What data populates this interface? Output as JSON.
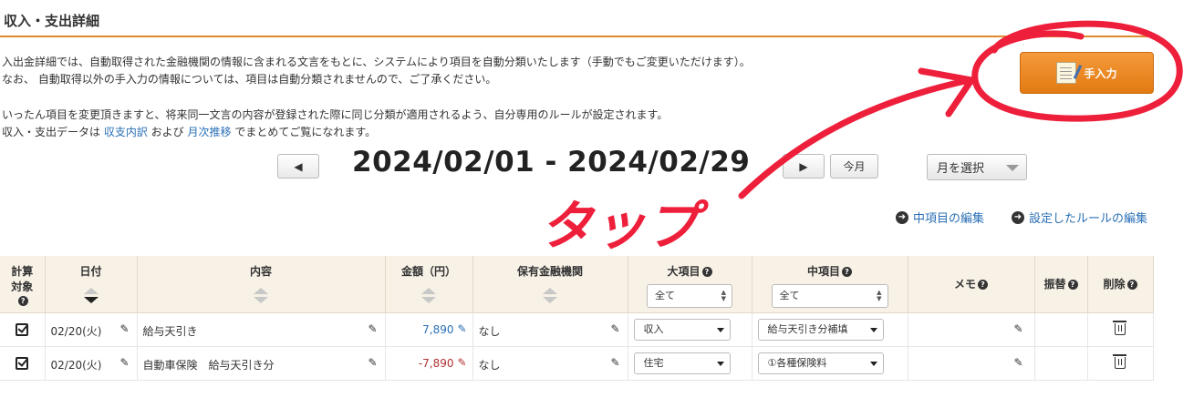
{
  "page": {
    "title": "収入・支出詳細"
  },
  "description": {
    "line1": "入出金詳細では、自動取得された金融機関の情報に含まれる文言をもとに、システムにより項目を自動分類いたします（手動でもご変更いただけます）。",
    "line2": "なお、 自動取得以外の手入力の情報については、項目は自動分類されませんので、ご了承ください。",
    "line3": "いったん項目を変更頂きますと、将来同一文言の内容が登録された際に同じ分類が適用されるよう、自分専用のルールが設定されます。",
    "line4_prefix": "収入・支出データは ",
    "link_summary": "収支内訳",
    "line4_mid": " および ",
    "link_monthly": "月次推移",
    "line4_suffix": " でまとめてご覧になれます。"
  },
  "manual_entry": {
    "label": "手入力",
    "icon": "notepad-icon"
  },
  "period": {
    "prev_label": "◀",
    "next_label": "▶",
    "range": "2024/02/01 - 2024/02/29",
    "this_month": "今月",
    "month_select": "月を選択"
  },
  "edit_links": {
    "categories": "中項目の編集",
    "rules": "設定したルールの編集"
  },
  "annotation": {
    "handwritten_text": "タップ",
    "color": "#ee1f3b"
  },
  "table": {
    "headers": {
      "target_line1": "計算",
      "target_line2": "対象",
      "date": "日付",
      "content": "内容",
      "amount": "金額（円）",
      "institution": "保有金融機関",
      "major": "大項目",
      "major_filter": "全て",
      "middle": "中項目",
      "middle_filter": "全て",
      "memo": "メモ",
      "transfer": "振替",
      "delete": "削除"
    },
    "rows": [
      {
        "date": "02/20(火)",
        "content": "給与天引き",
        "amount": "7,890",
        "amount_color": "#2a6fb5",
        "institution": "なし",
        "major": "収入",
        "middle": "給与天引き分補填"
      },
      {
        "date": "02/20(火)",
        "content": "自動車保険　給与天引き分",
        "amount": "-7,890",
        "amount_color": "#b03030",
        "institution": "なし",
        "major": "住宅",
        "middle": "①各種保険料"
      }
    ]
  }
}
